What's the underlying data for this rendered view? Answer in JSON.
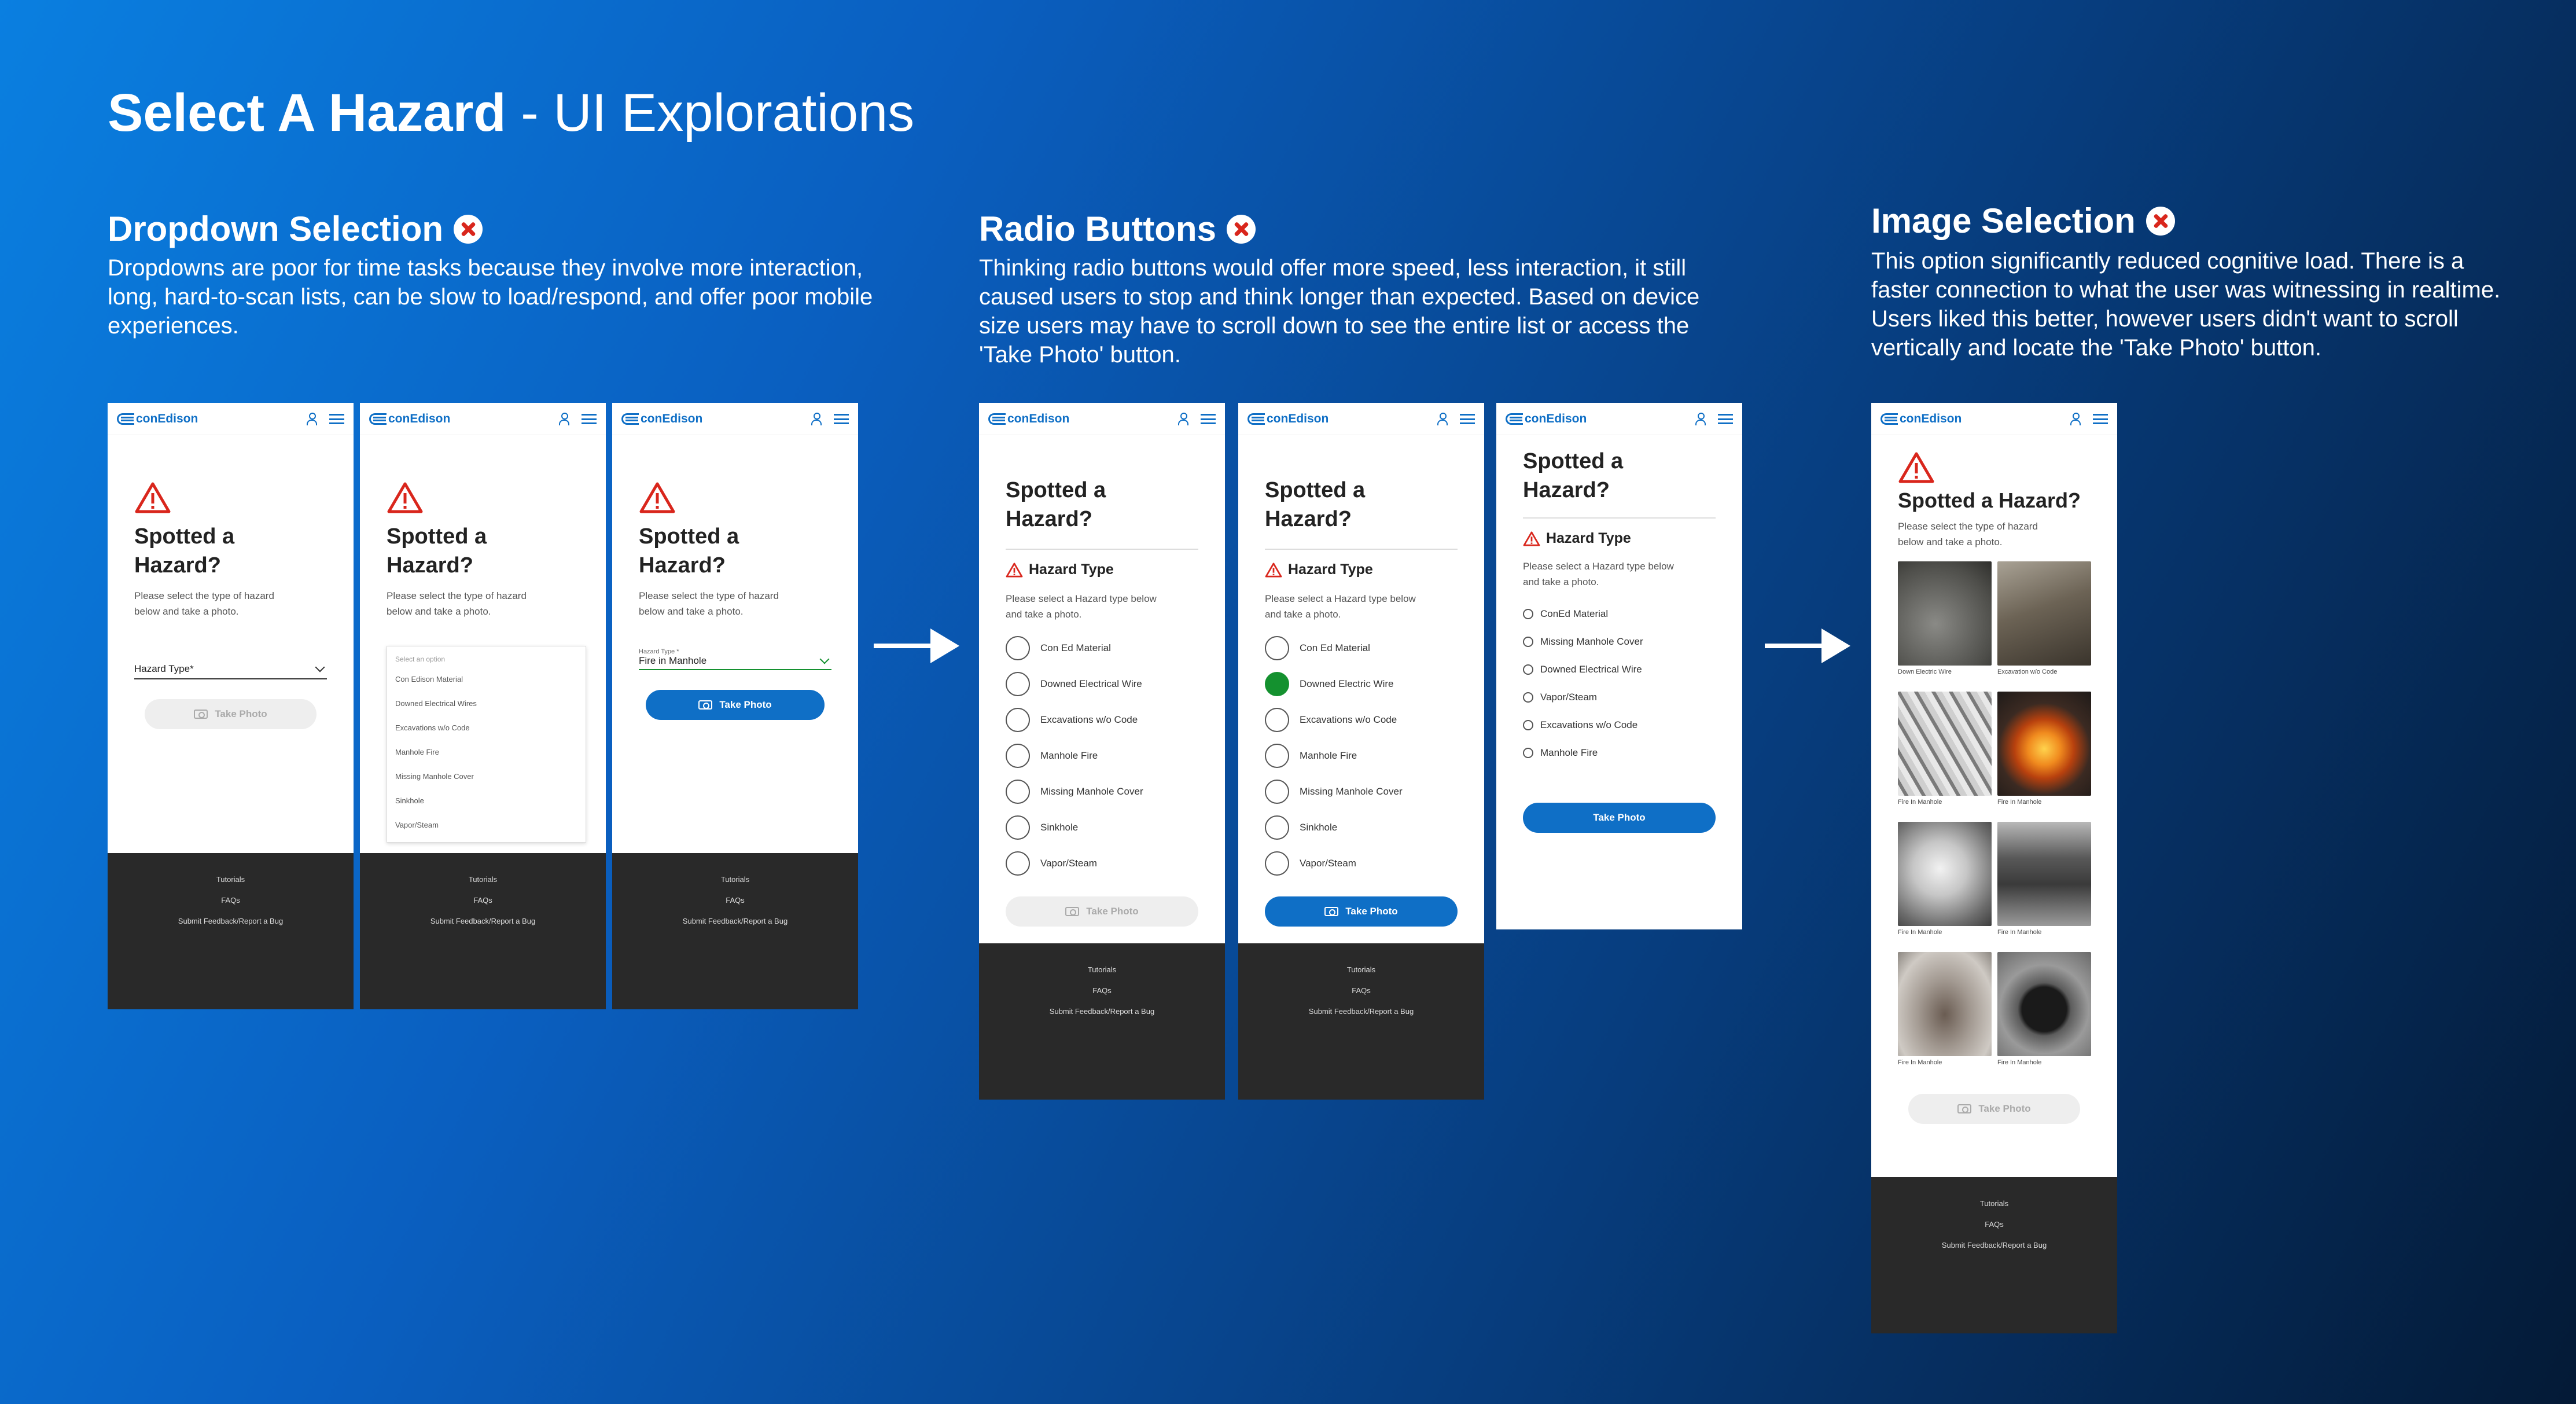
{
  "title": {
    "bold": "Select A Hazard",
    "light": "- UI Explorations"
  },
  "sections": [
    {
      "title": "Dropdown Selection",
      "desc": "Dropdowns are poor for time tasks because they involve more interaction, long, hard-to-scan lists, can be slow to load/respond, and offer poor mobile experiences."
    },
    {
      "title": "Radio Buttons",
      "desc": "Thinking radio buttons would offer more speed, less interaction, it still caused users to stop and think longer than expected. Based on device size users may have to scroll down to see the entire list or access the 'Take Photo' button."
    },
    {
      "title": "Image Selection",
      "desc": "This option significantly reduced cognitive load. There is a faster connection to what the user was witnessing in realtime. Users liked this better, however users didn't want to scroll vertically and locate the 'Take Photo' button."
    }
  ],
  "app": {
    "logo": "conEdison",
    "question": "Spotted a Hazard?",
    "question_l1": "Spotted a",
    "question_l2": "Hazard?",
    "subtitle_l1": "Please select the type of hazard",
    "subtitle_l2": "below and take a photo.",
    "hazard_type_label": "Hazard Type",
    "radio_sub_l1": "Please select a Hazard type below",
    "radio_sub_l2": "and take a photo.",
    "take_photo": "Take Photo",
    "select_label": "Hazard Type*",
    "select_label_small": "Hazard Type *",
    "selected_value": "Fire in Manhole",
    "dropdown_placeholder": "Select an option",
    "dropdown_options": [
      "Con Edison Material",
      "Downed Electrical Wires",
      "Excavations w/o Code",
      "Manhole Fire",
      "Missing Manhole Cover",
      "Sinkhole",
      "Vapor/Steam"
    ],
    "radio_options": [
      "Con Ed Material",
      "Downed Electrical Wire",
      "Excavations w/o Code",
      "Manhole Fire",
      "Missing Manhole Cover",
      "Sinkhole",
      "Vapor/Steam"
    ],
    "radio_options_selected": [
      "Con Ed Material",
      "Downed Electric Wire",
      "Excavations w/o Code",
      "Manhole Fire",
      "Missing Manhole Cover",
      "Sinkhole",
      "Vapor/Steam"
    ],
    "radio_options_compact": [
      "ConEd Material",
      "Missing Manhole Cover",
      "Downed Electrical Wire",
      "Vapor/Steam",
      "Excavations w/o Code",
      "Manhole Fire"
    ],
    "image_captions": [
      "Down Electric Wire",
      "Excavation w/o Code",
      "Fire In Manhole",
      "Fire In Manhole",
      "Fire In Manhole",
      "Fire In Manhole",
      "Fire In Manhole",
      "Fire In Manhole"
    ],
    "footer": [
      "Tutorials",
      "FAQs",
      "Submit Feedback/Report a Bug"
    ]
  },
  "colors": {
    "brand_blue": "#0f6fc6",
    "warning_red": "#d9261c",
    "selected_green": "#14912f",
    "footer_bg": "#292929"
  }
}
